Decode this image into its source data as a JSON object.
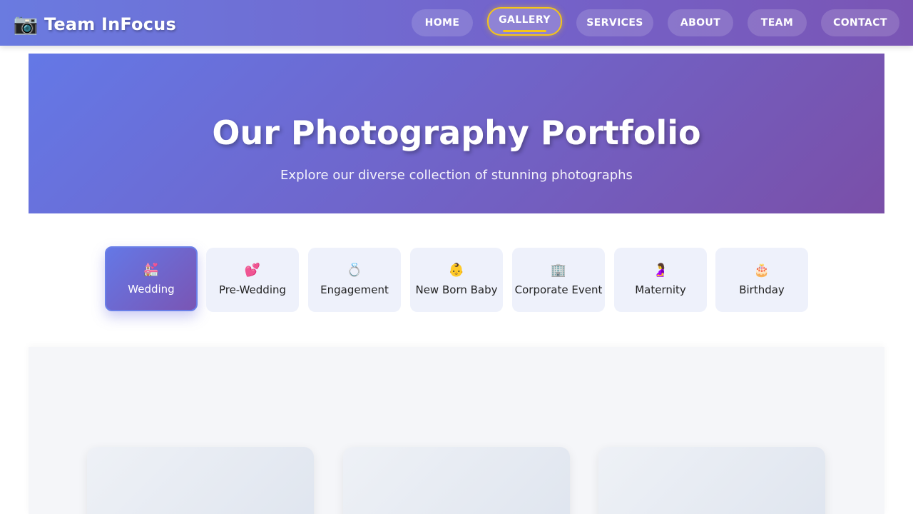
{
  "brand": {
    "icon": "camera-icon",
    "icon_glyph": "📷",
    "name": "Team InFocus"
  },
  "nav": {
    "items": [
      {
        "label": "HOME",
        "active": false
      },
      {
        "label": "GALLERY",
        "active": true
      },
      {
        "label": "SERVICES",
        "active": false
      },
      {
        "label": "ABOUT",
        "active": false
      },
      {
        "label": "TEAM",
        "active": false
      },
      {
        "label": "CONTACT",
        "active": false
      }
    ]
  },
  "hero": {
    "title": "Our Photography Portfolio",
    "subtitle": "Explore our diverse collection of stunning photographs"
  },
  "categories": [
    {
      "icon": "church-icon",
      "glyph": "💒",
      "label": "Wedding",
      "active": true
    },
    {
      "icon": "hearts-icon",
      "glyph": "💕",
      "label": "Pre-Wedding",
      "active": false
    },
    {
      "icon": "ring-icon",
      "glyph": "💍",
      "label": "Engagement",
      "active": false
    },
    {
      "icon": "baby-icon",
      "glyph": "👶",
      "label": "New Born Baby",
      "active": false
    },
    {
      "icon": "office-building-icon",
      "glyph": "🏢",
      "label": "Corporate Event",
      "active": false
    },
    {
      "icon": "pregnant-woman-icon",
      "glyph": "🤰",
      "label": "Maternity",
      "active": false
    },
    {
      "icon": "birthday-cake-icon",
      "glyph": "🎂",
      "label": "Birthday",
      "active": false
    }
  ],
  "colors": {
    "accent": "#6a7be0",
    "accent_dark": "#7a55b4",
    "active_border": "#f5c518",
    "tab_bg": "#eef1fb"
  }
}
